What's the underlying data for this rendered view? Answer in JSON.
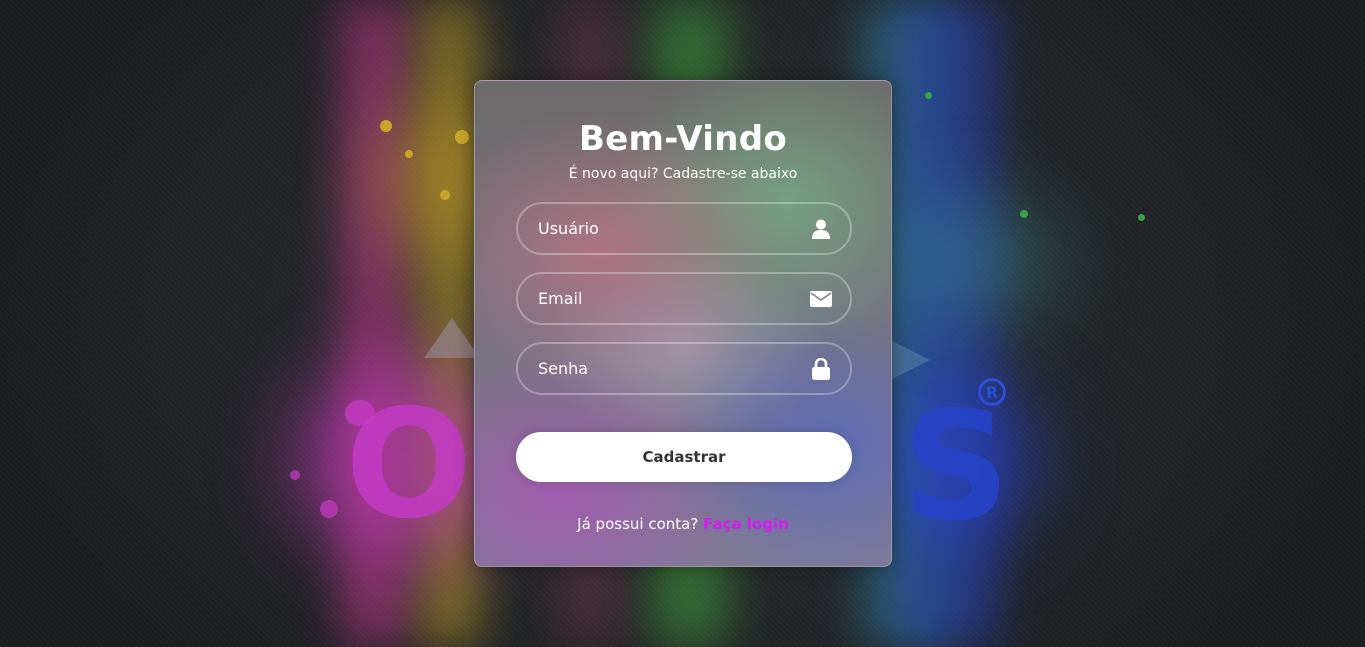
{
  "form": {
    "title": "Bem-Vindo",
    "subtitle": "É novo aqui? Cadastre-se abaixo",
    "fields": [
      {
        "placeholder": "Usuário",
        "icon": "user-icon"
      },
      {
        "placeholder": "Email",
        "icon": "envelope-icon"
      },
      {
        "placeholder": "Senha",
        "icon": "lock-icon"
      }
    ],
    "submit_label": "Cadastrar",
    "footer_text": "Já possui conta?",
    "footer_link": "Faça login"
  },
  "background": {
    "registered_mark": "R"
  },
  "colors": {
    "link": "#d21cf0",
    "button_bg": "#ffffff",
    "button_text": "#333333"
  }
}
